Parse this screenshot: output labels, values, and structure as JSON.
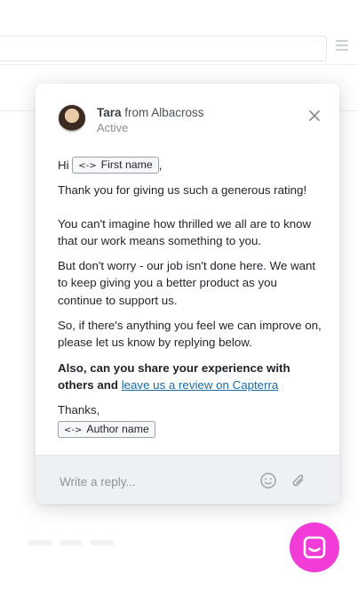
{
  "colors": {
    "launcher": "#f13cd7",
    "link": "#1a6ba8",
    "footer_bg": "#eef1f3"
  },
  "icons": {
    "close": "close-icon",
    "emoji": "emoji-icon",
    "attach": "paperclip-icon",
    "launcher": "chat-bubble-icon",
    "chip": "code-arrows-icon"
  },
  "header": {
    "sender_name": "Tara",
    "sender_from": "from Albacross",
    "status": "Active"
  },
  "message": {
    "greeting": "Hi",
    "first_name_chip": "First name",
    "greeting_end": ",",
    "p1": "Thank you for giving us such a generous rating!",
    "p2": "You can't imagine how thrilled we all are to know that our work means something to you.",
    "p3": "But don't worry - our job isn't done here. We want to keep giving you a better product as you continue to support us.",
    "p4": "So, if there's anything you feel we can improve on, please let us know by replying below.",
    "p5_bold": "Also, can you share your experience with others and",
    "p5_link": "leave us a review on Capterra",
    "signoff": "Thanks,",
    "author_chip": "Author name"
  },
  "reply": {
    "placeholder": "Write a reply..."
  }
}
